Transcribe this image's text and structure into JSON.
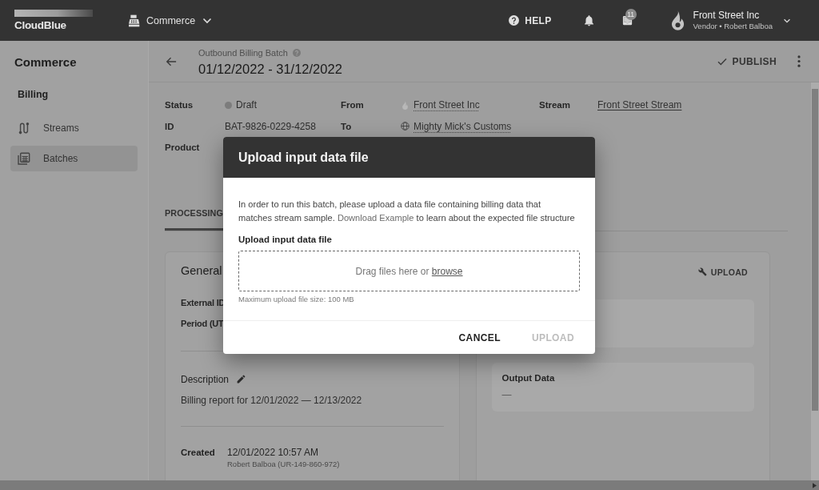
{
  "top_bar": {
    "logo": "CloudBlue",
    "module": "Commerce",
    "help": "HELP",
    "inbox_badge": "11",
    "account": {
      "name": "Front Street Inc",
      "role": "Vendor • Robert Balboa"
    }
  },
  "sidebar": {
    "title": "Commerce",
    "section": "Billing",
    "items": [
      {
        "label": "Streams",
        "selected": false
      },
      {
        "label": "Batches",
        "selected": true
      }
    ]
  },
  "header": {
    "overline": "Outbound Billing Batch",
    "title": "01/12/2022 - 31/12/2022",
    "action": "PUBLISH"
  },
  "details": [
    [
      {
        "label": "Status",
        "value": "Draft",
        "kind": "status"
      },
      {
        "label": "From",
        "value": "Front Street Inc",
        "kind": "account"
      },
      {
        "label": "Stream",
        "value": "Front Street Stream",
        "kind": "link"
      }
    ],
    [
      {
        "label": "ID",
        "value": "BAT-9826-0229-4258",
        "kind": "text"
      },
      {
        "label": "To",
        "value": "Mighty Mick's Customs",
        "kind": "customer"
      }
    ],
    [
      {
        "label": "Product",
        "kind": "text"
      }
    ]
  ],
  "tabs": [
    {
      "label": "PROCESSING",
      "selected": true
    }
  ],
  "general_card": {
    "title": "General",
    "fields": [
      "External ID",
      "Period (UT"
    ],
    "description_label": "Description",
    "description": "Billing report for 12/01/2022 — 12/13/2022",
    "created": {
      "label": "Created",
      "date": "12/01/2022 10:57 AM",
      "by": "Robert Balboa (UR-149-860-972)"
    }
  },
  "data_card": {
    "action": "UPLOAD",
    "panels": [
      {
        "title": "Output Data",
        "value": "—"
      }
    ]
  },
  "dialog": {
    "title": "Upload input data file",
    "message_line_1": "In order to run this batch, please upload a data file containing billing data that",
    "message_line_2": "matches stream sample.",
    "link": "Download Example",
    "message_end": "to learn about the expected file structure",
    "field_label": "Upload input data file",
    "dropzone_text": "Drag files here or",
    "dropzone_link": "browse",
    "hint": "Maximum upload file size: 100 MB",
    "buttons": [
      {
        "label": "CANCEL",
        "disabled": false
      },
      {
        "label": "UPLOAD",
        "disabled": true
      }
    ]
  }
}
